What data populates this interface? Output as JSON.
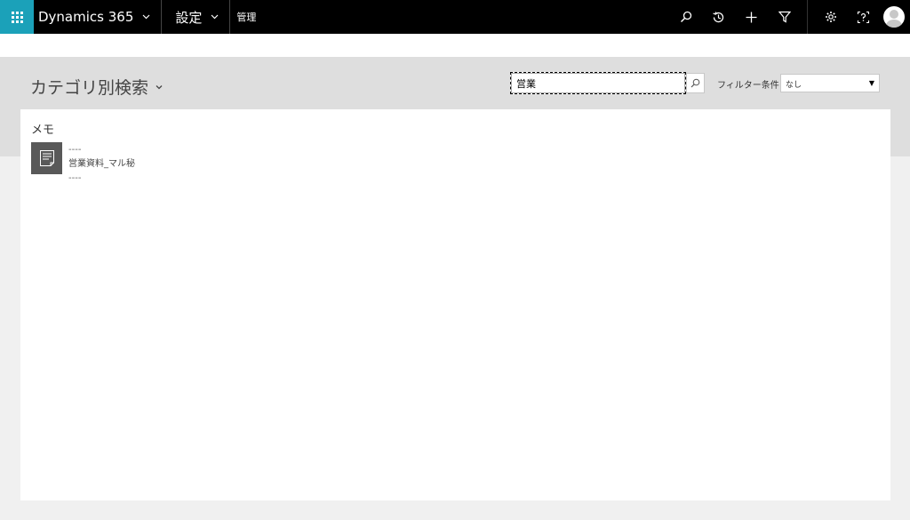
{
  "topbar": {
    "brand": "Dynamics 365",
    "area": "設定",
    "breadcrumb": "管理"
  },
  "header": {
    "title": "カテゴリ別検索",
    "search": {
      "value": "営業"
    },
    "filter": {
      "label": "フィルター条件",
      "selected": "なし"
    }
  },
  "results": {
    "section_title": "メモ",
    "items": [
      {
        "line1": "----",
        "line2": "営業資料_マル秘",
        "line3": "----"
      }
    ]
  },
  "colors": {
    "topbar_bg": "#000000",
    "waffle_bg": "#1ba1b9",
    "band_bg": "#dedede",
    "page_bg": "#f0f0f0",
    "icon_tile": "#595959"
  }
}
